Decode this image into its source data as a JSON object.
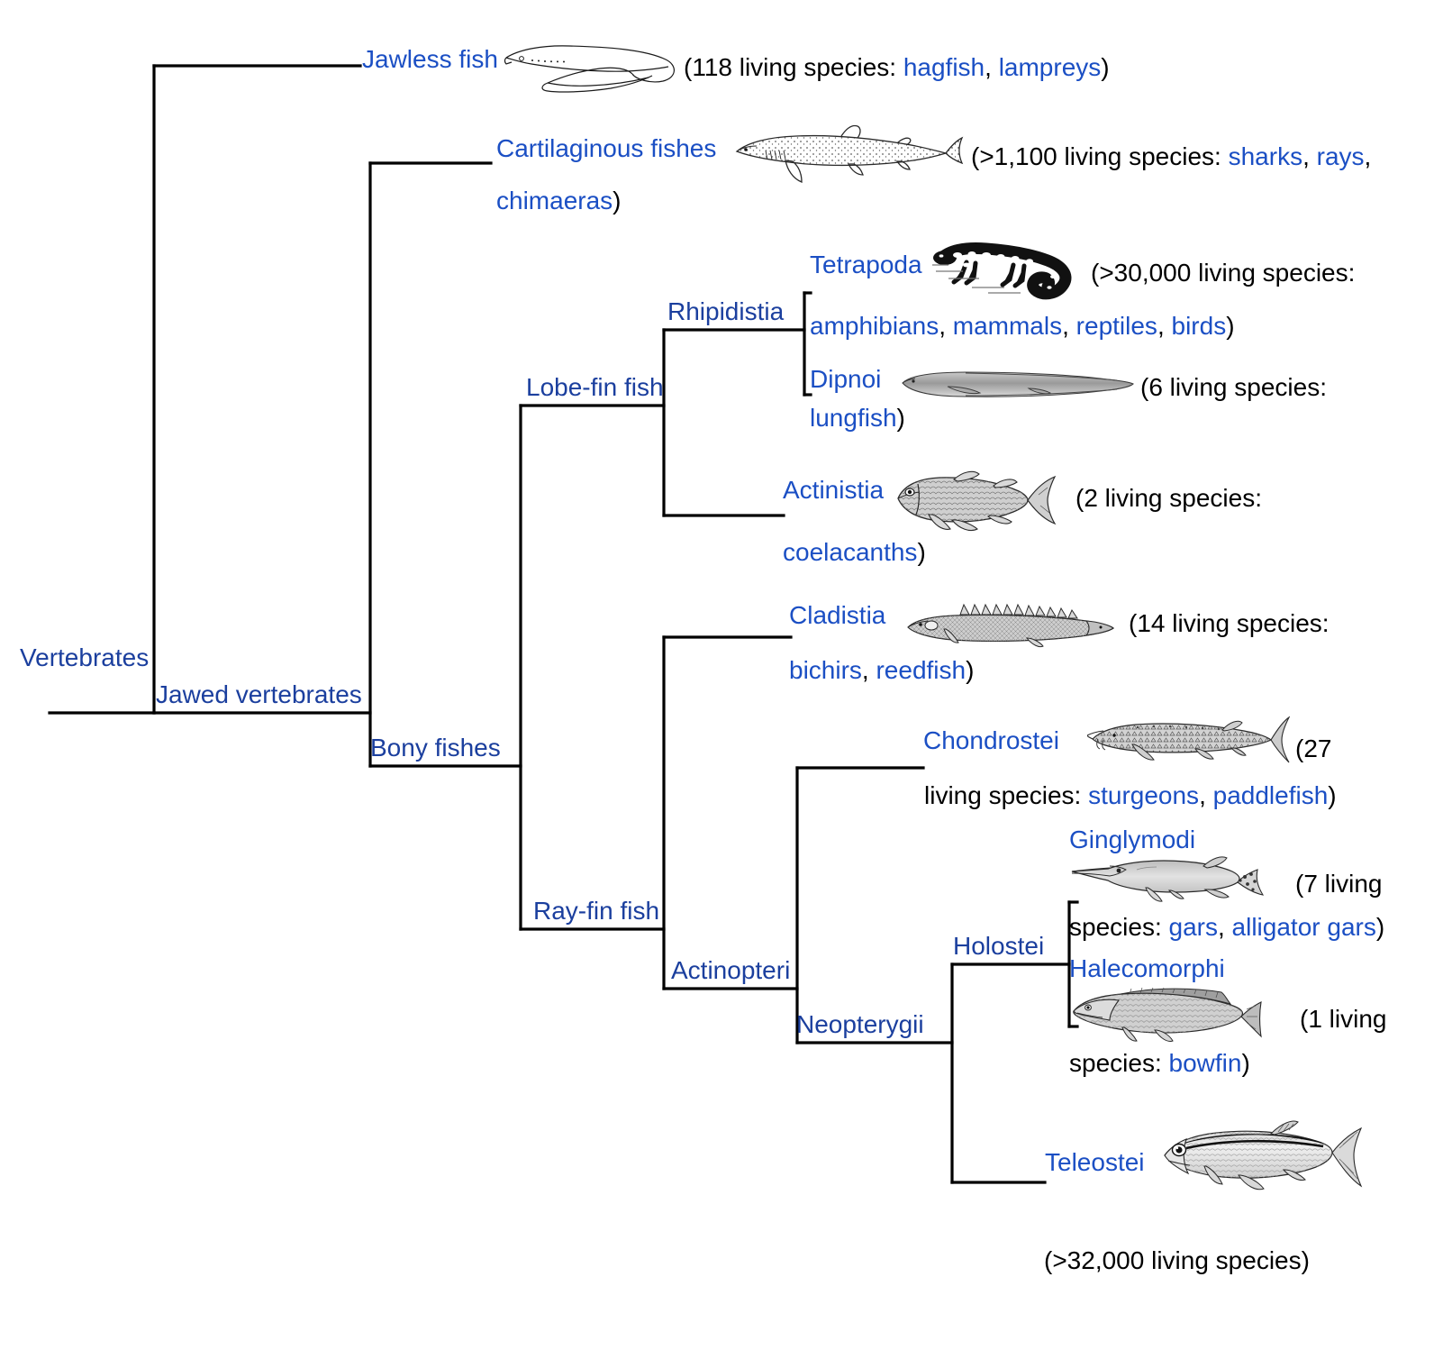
{
  "diagram": {
    "type": "cladogram",
    "title": "Phylogenetic tree of vertebrates / fishes",
    "link_color": "#1b4fc4",
    "text_color": "#000000",
    "line_color": "#000000",
    "background": "#ffffff"
  },
  "nodes": {
    "vertebrates": "Vertebrates",
    "jawed_vertebrates": "Jawed vertebrates",
    "bony_fishes": "Bony fishes",
    "lobe_fin_fish": "Lobe-fin fish",
    "ray_fin_fish": "Ray-fin fish",
    "rhipidistia": "Rhipidistia",
    "actinopteri": "Actinopteri",
    "neopterygii": "Neopterygii",
    "holostei": "Holostei"
  },
  "tips": {
    "jawless_fish": "Jawless fish",
    "cartilaginous_fishes": "Cartilaginous fishes",
    "tetrapoda": "Tetrapoda",
    "dipnoi": "Dipnoi",
    "actinistia": "Actinistia",
    "cladistia": "Cladistia",
    "chondrostei": "Chondrostei",
    "ginglymodi": "Ginglymodi",
    "halecomorphi": "Halecomorphi",
    "teleostei": "Teleostei"
  },
  "annotations": {
    "jawless_fish": {
      "p1": "(118 living species: ",
      "l1": "hagfish",
      "s1": ", ",
      "l2": "lampreys",
      "p2": ")"
    },
    "cartilaginous_fishes": {
      "p1": "(>1,100 living species: ",
      "l1": "sharks",
      "s1": ", ",
      "l2": "rays",
      "s2": ", ",
      "l3": "chimaeras",
      "p2": ")"
    },
    "tetrapoda": {
      "p1": "(>30,000 living species: ",
      "l1": "amphibians",
      "s1": ", ",
      "l2": "mammals",
      "s2": ", ",
      "l3": "reptiles",
      "s3": ", ",
      "l4": "birds",
      "p2": ")"
    },
    "dipnoi": {
      "p1": "(6 living species: ",
      "l1": "lungfish",
      "p2": ")"
    },
    "actinistia": {
      "p1": "(2 living species: ",
      "l1": "coelacanths",
      "p2": ")"
    },
    "cladistia": {
      "p1": "(14 living species: ",
      "l1": "bichirs",
      "s1": ", ",
      "l2": "reedfish",
      "p2": ")"
    },
    "chondrostei": {
      "p1": "(27 living species: ",
      "l1": "sturgeons",
      "s1": ", ",
      "l2": "paddlefish",
      "p2": ")"
    },
    "ginglymodi": {
      "p1": "(7 living species: ",
      "l1": "gars",
      "s1": ", ",
      "l2": "alligator gars",
      "p2": ")"
    },
    "halecomorphi": {
      "p1": "(1 living species: ",
      "l1": "bowfin",
      "p2": ")"
    },
    "teleostei": {
      "p1": "(>32,000 living species)"
    }
  },
  "annotation_lines": {
    "jawless_line1_a": "(118 living species: ",
    "cart_line1_a": "(>1,100 living species: ",
    "cart_line2_end": ")",
    "tetra_line1_a": "(>30,000 living species:",
    "tetra_line2_end": ")",
    "dipnoi_line1_a": "(6 living species:",
    "dipnoi_line2_end": ")",
    "actinistia_line1_a": "(2 living species:",
    "actinistia_line2_end": ")",
    "cladistia_line1_a": "(14 living species:",
    "cladistia_line2_end": ")",
    "chondrostei_line1_a": "(27",
    "chondrostei_line2_a": "living species: ",
    "chondrostei_line2_end": ")",
    "gingly_line1_a": "(7 living",
    "gingly_line2_a": "species: ",
    "gingly_line2_end": ")",
    "halec_line1_a": "(1 living",
    "halec_line2_a": "species: ",
    "halec_line2_end": ")",
    "teleostei_line": "(>32,000 living species)"
  },
  "illustrations": {
    "jawless_fish": "hagfish-illustration",
    "cartilaginous_fishes": "shark-illustration",
    "tetrapoda": "salamander-illustration",
    "dipnoi": "lungfish-illustration",
    "actinistia": "coelacanth-illustration",
    "cladistia": "bichir-illustration",
    "chondrostei": "sturgeon-illustration",
    "ginglymodi": "gar-illustration",
    "halecomorphi": "bowfin-illustration",
    "teleostei": "teleost-illustration"
  }
}
